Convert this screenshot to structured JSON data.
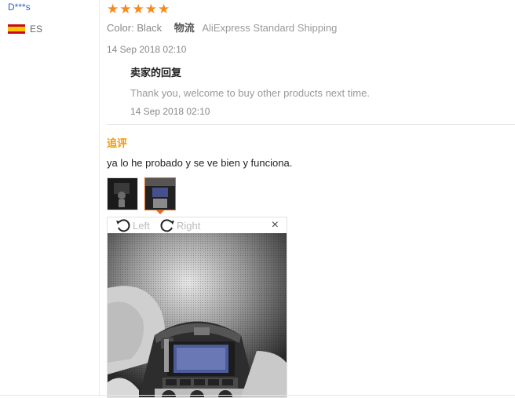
{
  "reviewer": {
    "name": "D***s",
    "country": "ES"
  },
  "rating": {
    "stars": 5
  },
  "order": {
    "color_label": "Color:",
    "color_value": "Black",
    "shipping_label": "物流",
    "shipping_value": "AliExpress Standard Shipping"
  },
  "review": {
    "date": "14 Sep 2018 02:10"
  },
  "seller_reply": {
    "title": "卖家的回复",
    "text": "Thank you, welcome to buy other products next time.",
    "date": "14 Sep 2018 02:10"
  },
  "followup": {
    "label": "追评",
    "text": "ya lo he probado y se ve bien y funciona."
  },
  "viewer": {
    "rotate_left": "Left",
    "rotate_right": "Right",
    "close": "×"
  },
  "colors": {
    "accent": "#f78a1b",
    "followup": "#f39800",
    "link": "#2b64c5"
  }
}
